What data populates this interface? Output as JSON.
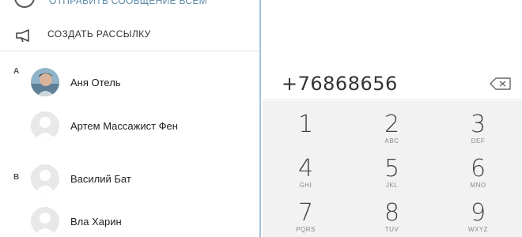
{
  "contacts_panel": {
    "top_text": "ОТПРАВИТЬ СООБЩЕНИЕ ВСЕМ",
    "broadcast_label": "СОЗДАТЬ РАССЫЛКУ",
    "sections": [
      {
        "letter": "А",
        "contacts": [
          {
            "name": "Аня Отель",
            "avatar": "photo"
          },
          {
            "name": "Артем Массажист Фен",
            "avatar": "placeholder"
          }
        ]
      },
      {
        "letter": "В",
        "contacts": [
          {
            "name": "Василий Бат",
            "avatar": "placeholder"
          },
          {
            "name": "Вла Харин",
            "avatar": "placeholder"
          }
        ]
      }
    ]
  },
  "dialer": {
    "number": "+76868656",
    "keys": [
      {
        "digit": "1",
        "letters": ""
      },
      {
        "digit": "2",
        "letters": "ABC"
      },
      {
        "digit": "3",
        "letters": "DEF"
      },
      {
        "digit": "4",
        "letters": "GHI"
      },
      {
        "digit": "5",
        "letters": "JKL"
      },
      {
        "digit": "6",
        "letters": "MNO"
      },
      {
        "digit": "7",
        "letters": "PQRS"
      },
      {
        "digit": "8",
        "letters": "TUV"
      },
      {
        "digit": "9",
        "letters": "WXYZ"
      }
    ]
  },
  "colors": {
    "pane_border": "#9fc3d9",
    "keypad_bg": "#f2f2f2"
  }
}
